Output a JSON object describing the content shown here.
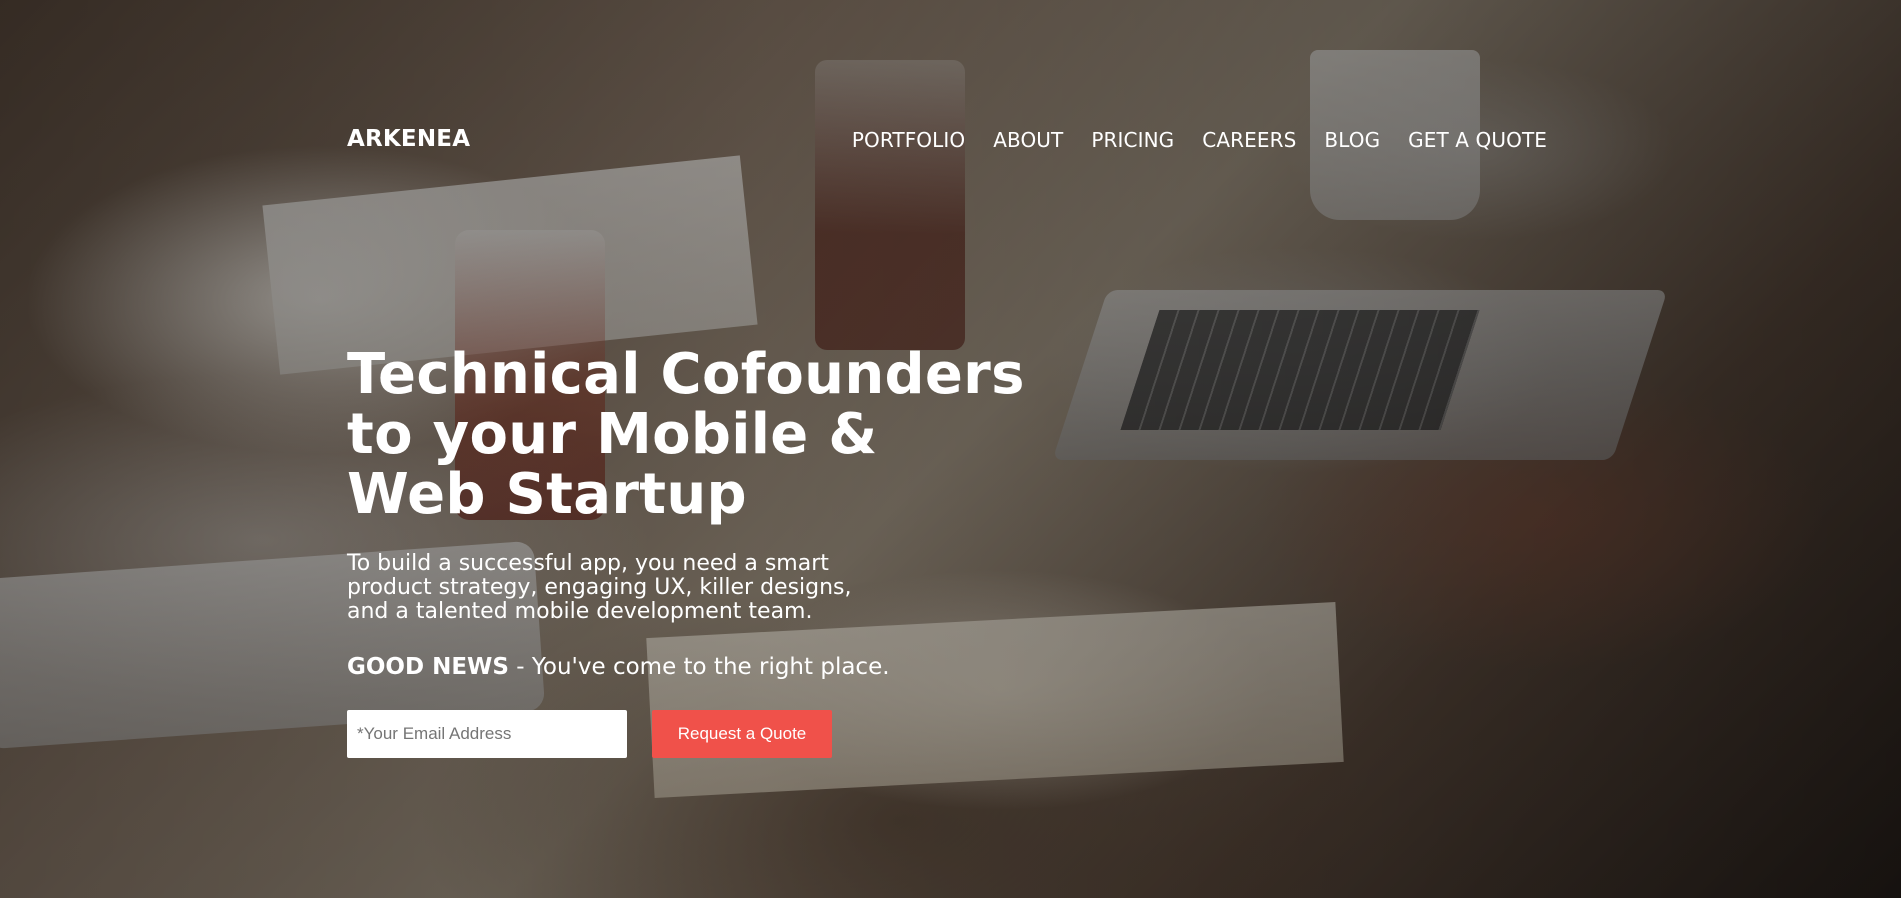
{
  "brand": {
    "logo_text": "ARKENEA"
  },
  "nav": {
    "items": [
      {
        "label": "PORTFOLIO"
      },
      {
        "label": "ABOUT"
      },
      {
        "label": "PRICING"
      },
      {
        "label": "CAREERS"
      },
      {
        "label": "BLOG"
      },
      {
        "label": "GET A QUOTE"
      }
    ]
  },
  "hero": {
    "headline_lines": [
      "Technical Cofounders",
      "to your Mobile &",
      "Web Startup"
    ],
    "subtext_lines": [
      "To build a successful app, you need a smart",
      "product strategy, engaging UX, killer designs,",
      "and a talented mobile development team."
    ],
    "good_news_bold": "GOOD NEWS",
    "good_news_rest": " - You've come to the right place.",
    "background_image": "team-working-at-desk-photo"
  },
  "form": {
    "email_value": "",
    "email_placeholder": "*Your Email Address",
    "submit_label": "Request a Quote"
  },
  "colors": {
    "accent": "#f0514a",
    "text": "#ffffff",
    "input_bg": "#ffffff"
  }
}
